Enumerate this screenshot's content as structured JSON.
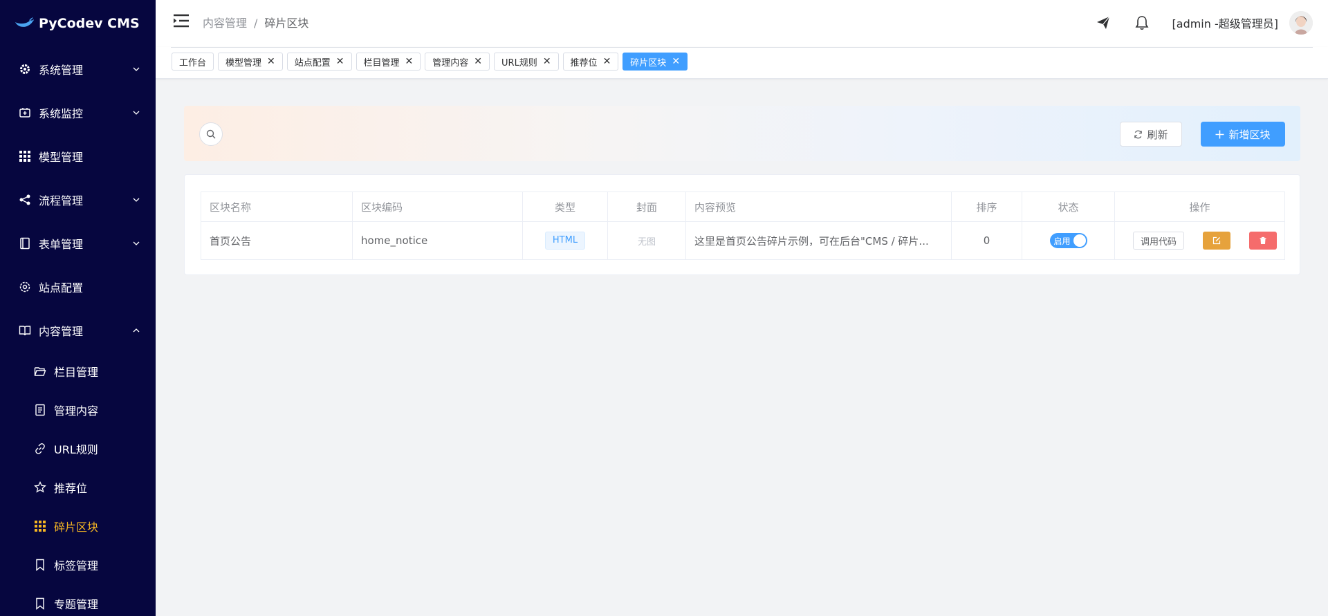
{
  "app": {
    "title": "PyCodev CMS"
  },
  "sidebar": {
    "menu": [
      {
        "label": "系统管理",
        "icon": "gear-icon",
        "expandable": true,
        "expanded": false
      },
      {
        "label": "系统监控",
        "icon": "monitor-icon",
        "expandable": true,
        "expanded": false
      },
      {
        "label": "模型管理",
        "icon": "grid-icon",
        "expandable": false
      },
      {
        "label": "流程管理",
        "icon": "share-icon",
        "expandable": true,
        "expanded": false
      },
      {
        "label": "表单管理",
        "icon": "form-icon",
        "expandable": true,
        "expanded": false
      },
      {
        "label": "站点配置",
        "icon": "settings-icon",
        "expandable": false
      },
      {
        "label": "内容管理",
        "icon": "book-icon",
        "expandable": true,
        "expanded": true
      }
    ],
    "submenu": [
      {
        "label": "栏目管理",
        "icon": "folder-icon"
      },
      {
        "label": "管理内容",
        "icon": "document-icon"
      },
      {
        "label": "URL规则",
        "icon": "link-icon"
      },
      {
        "label": "推荐位",
        "icon": "star-icon"
      },
      {
        "label": "碎片区块",
        "icon": "grid-icon",
        "active": true
      },
      {
        "label": "标签管理",
        "icon": "bookmark-icon"
      },
      {
        "label": "专题管理",
        "icon": "bookmark-icon"
      }
    ],
    "active_color": "#f5b623"
  },
  "header": {
    "breadcrumb": [
      "内容管理",
      "碎片区块"
    ],
    "user": "[admin -超级管理员]"
  },
  "tags": [
    {
      "label": "工作台",
      "closable": false
    },
    {
      "label": "模型管理",
      "closable": true
    },
    {
      "label": "站点配置",
      "closable": true
    },
    {
      "label": "栏目管理",
      "closable": true
    },
    {
      "label": "管理内容",
      "closable": true
    },
    {
      "label": "URL规则",
      "closable": true
    },
    {
      "label": "推荐位",
      "closable": true
    },
    {
      "label": "碎片区块",
      "closable": true,
      "active": true
    }
  ],
  "toolbar": {
    "refresh_label": "刷新",
    "add_label": "新增区块"
  },
  "table": {
    "columns": [
      "区块名称",
      "区块编码",
      "类型",
      "封面",
      "内容预览",
      "排序",
      "状态",
      "操作"
    ],
    "rows": [
      {
        "name": "首页公告",
        "code": "home_notice",
        "type": "HTML",
        "cover": "无图",
        "preview": "这里是首页公告碎片示例，可在后台\"CMS / 碎片...",
        "sort": "0",
        "status": "启用",
        "enabled": true,
        "code_button": "调用代码"
      }
    ]
  },
  "colors": {
    "primary": "#409eff",
    "warning": "#e6a23c",
    "danger": "#f56c6c",
    "sidebar_bg": "#06063f"
  }
}
